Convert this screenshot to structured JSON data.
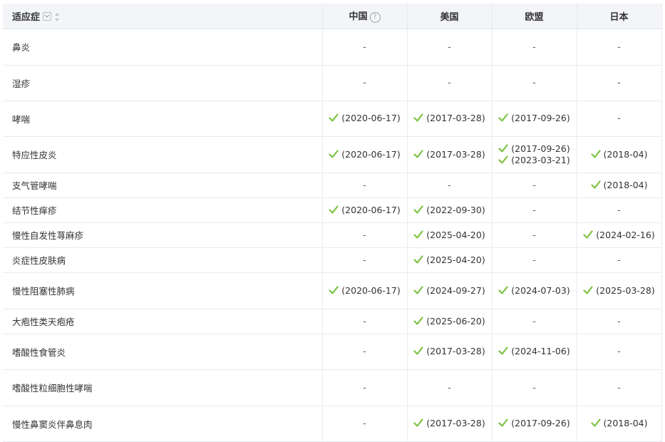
{
  "header": {
    "indication": "适应症",
    "china": "中国",
    "us": "美国",
    "eu": "欧盟",
    "japan": "日本"
  },
  "check_color": "#7cc242",
  "rows": [
    {
      "name": "鼻炎",
      "h": 51,
      "cn": [
        "-"
      ],
      "us": [
        "-"
      ],
      "eu": [
        "-"
      ],
      "jp": [
        "-"
      ]
    },
    {
      "name": "湿疹",
      "h": 50,
      "cn": [
        "-"
      ],
      "us": [
        "-"
      ],
      "eu": [
        "-"
      ],
      "jp": [
        "-"
      ]
    },
    {
      "name": "哮喘",
      "h": 50,
      "cn": [
        "(2020-06-17)"
      ],
      "us": [
        "(2017-03-28)"
      ],
      "eu": [
        "(2017-09-26)"
      ],
      "jp": [
        "-"
      ]
    },
    {
      "name": "特应性皮炎",
      "h": 51,
      "cn": [
        "(2020-06-17)"
      ],
      "us": [
        "(2017-03-28)"
      ],
      "eu": [
        "(2017-09-26)",
        "(2023-03-21)"
      ],
      "jp": [
        "(2018-04)"
      ]
    },
    {
      "name": "支气管哮喘",
      "h": 35,
      "cn": [
        "-"
      ],
      "us": [
        "-"
      ],
      "eu": [
        "-"
      ],
      "jp": [
        "(2018-04)"
      ]
    },
    {
      "name": "结节性痒疹",
      "h": 35,
      "cn": [
        "(2020-06-17)"
      ],
      "us": [
        "(2022-09-30)"
      ],
      "eu": [
        "-"
      ],
      "jp": [
        "-"
      ]
    },
    {
      "name": "慢性自发性荨麻疹",
      "h": 35,
      "cn": [
        "-"
      ],
      "us": [
        "(2025-04-20)"
      ],
      "eu": [
        "-"
      ],
      "jp": [
        "(2024-02-16)"
      ]
    },
    {
      "name": "炎症性皮肤病",
      "h": 35,
      "cn": [
        "-"
      ],
      "us": [
        "(2025-04-20)"
      ],
      "eu": [
        "-"
      ],
      "jp": [
        "-"
      ]
    },
    {
      "name": "慢性阻塞性肺病",
      "h": 51,
      "cn": [
        "(2020-06-17)"
      ],
      "us": [
        "(2024-09-27)"
      ],
      "eu": [
        "(2024-07-03)"
      ],
      "jp": [
        "(2025-03-28)"
      ]
    },
    {
      "name": "大疱性类天疱疮",
      "h": 35,
      "cn": [
        "-"
      ],
      "us": [
        "(2025-06-20)"
      ],
      "eu": [
        "-"
      ],
      "jp": [
        "-"
      ]
    },
    {
      "name": "嗜酸性食管炎",
      "h": 50,
      "cn": [
        "-"
      ],
      "us": [
        "(2017-03-28)"
      ],
      "eu": [
        "(2024-11-06)"
      ],
      "jp": [
        "-"
      ]
    },
    {
      "name": "嗜酸性粒细胞性哮喘",
      "h": 51,
      "cn": [
        "-"
      ],
      "us": [
        "-"
      ],
      "eu": [
        "-"
      ],
      "jp": [
        "-"
      ]
    },
    {
      "name": "慢性鼻窦炎伴鼻息肉",
      "h": 50,
      "cn": [
        "-"
      ],
      "us": [
        "(2017-03-28)"
      ],
      "eu": [
        "(2017-09-26)"
      ],
      "jp": [
        "(2018-04)"
      ]
    }
  ]
}
